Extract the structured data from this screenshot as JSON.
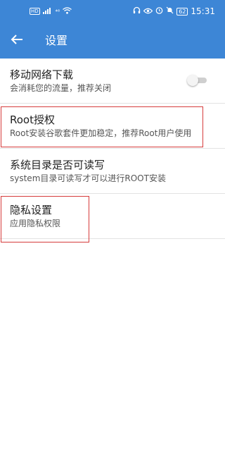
{
  "status_bar": {
    "hd": "HD",
    "signal": "⁴⁶",
    "time": "15:31",
    "battery": "62",
    "icons": [
      "headphones-icon",
      "eye-icon",
      "alarm-icon",
      "mute-icon"
    ]
  },
  "app_bar": {
    "title": "设置",
    "back_icon": "arrow-left-icon"
  },
  "settings": [
    {
      "title": "移动网络下载",
      "subtitle": "会消耗您的流量，推荐关闭",
      "toggle": "off"
    },
    {
      "title": "Root授权",
      "subtitle": "Root安装谷歌套件更加稳定，推荐Root用户使用"
    },
    {
      "title": "系统目录是否可读写",
      "subtitle": "system目录可读写才可以进行ROOT安装"
    },
    {
      "title": "隐私设置",
      "subtitle": "应用隐私权限"
    }
  ],
  "colors": {
    "primary": "#3d86d6",
    "highlight": "#d63c3c"
  }
}
